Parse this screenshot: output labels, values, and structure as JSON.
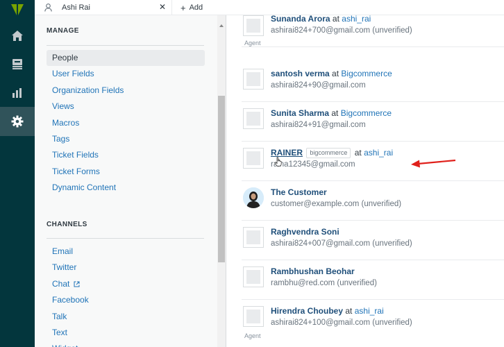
{
  "topbar": {
    "tab_title": "Ashi Rai",
    "add_label": "Add"
  },
  "rail": {
    "items": [
      "home-icon",
      "views-icon",
      "reporting-icon",
      "admin-settings-icon"
    ],
    "colors": {
      "bg": "#03363d",
      "active": "#30535a",
      "logo": "#78a300"
    }
  },
  "panel": {
    "manage_title": "MANAGE",
    "manage_items": [
      "People",
      "User Fields",
      "Organization Fields",
      "Views",
      "Macros",
      "Tags",
      "Ticket Fields",
      "Ticket Forms",
      "Dynamic Content"
    ],
    "active_item": "People",
    "channels_title": "CHANNELS",
    "channel_items": [
      "Email",
      "Twitter",
      "Chat",
      "Facebook",
      "Talk",
      "Text",
      "Widget"
    ]
  },
  "people": [
    {
      "name": "Sunanda Arora",
      "at": "at",
      "org": "ashi_rai",
      "email": "ashirai824+700@gmail.com (unverified)",
      "role": "Agent"
    },
    {
      "name": "santosh verma",
      "at": "at",
      "org": "Bigcommerce",
      "email": "ashirai824+90@gmail.com",
      "role": ""
    },
    {
      "name": "Sunita Sharma",
      "at": "at",
      "org": "Bigcommerce",
      "email": "ashirai824+91@gmail.com",
      "role": ""
    },
    {
      "name": "RAINER",
      "badge": "bigcommerce",
      "at": "at",
      "org": "ashi_rai",
      "email": "raina12345@gmail.com",
      "role": ""
    },
    {
      "name": "The Customer",
      "at": "",
      "org": "",
      "email": "customer@example.com (unverified)",
      "role": ""
    },
    {
      "name": "Raghvendra Soni",
      "at": "",
      "org": "",
      "email": "ashirai824+007@gmail.com (unverified)",
      "role": ""
    },
    {
      "name": "Rambhushan Beohar",
      "at": "",
      "org": "",
      "email": "rambhu@red.com (unverified)",
      "role": ""
    },
    {
      "name": "Hirendra Choubey",
      "at": "at",
      "org": "ashi_rai",
      "email": "ashirai824+100@gmail.com (unverified)",
      "role": "Agent"
    }
  ],
  "annotation": {
    "arrow_color": "#e0201b"
  }
}
